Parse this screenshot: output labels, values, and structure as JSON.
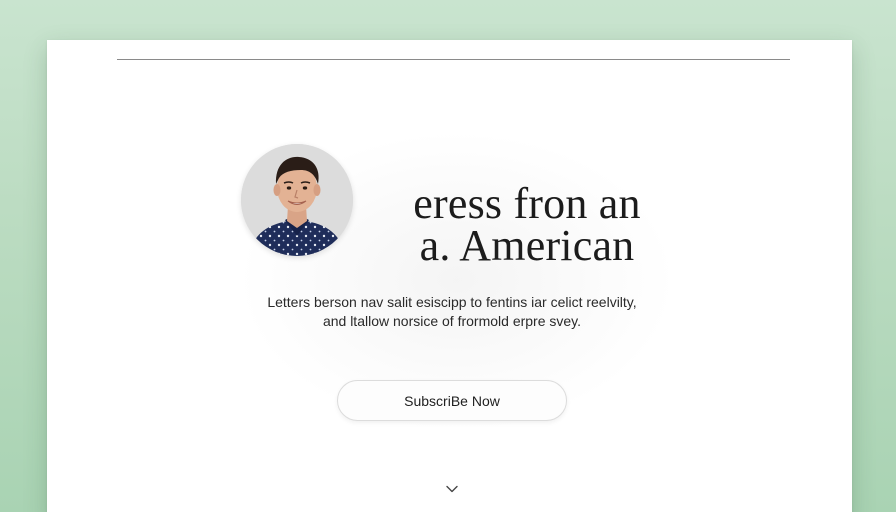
{
  "hero": {
    "headline_line1": "eress fron an",
    "headline_line2": "a. American",
    "body_line1": "Letters berson nav salit esiscipp to fentins iar celict reelvilty,",
    "body_line2": "and ltallow norsice of frormold erpre svey."
  },
  "cta": {
    "subscribe_label": "SubscriBe Now"
  },
  "icons": {
    "scroll": "chevron-down-icon",
    "avatar": "person-portrait"
  },
  "colors": {
    "background": "#bcdcc2",
    "card": "#ffffff",
    "text": "#1c1c1c",
    "shirt": "#1f2d5a"
  }
}
